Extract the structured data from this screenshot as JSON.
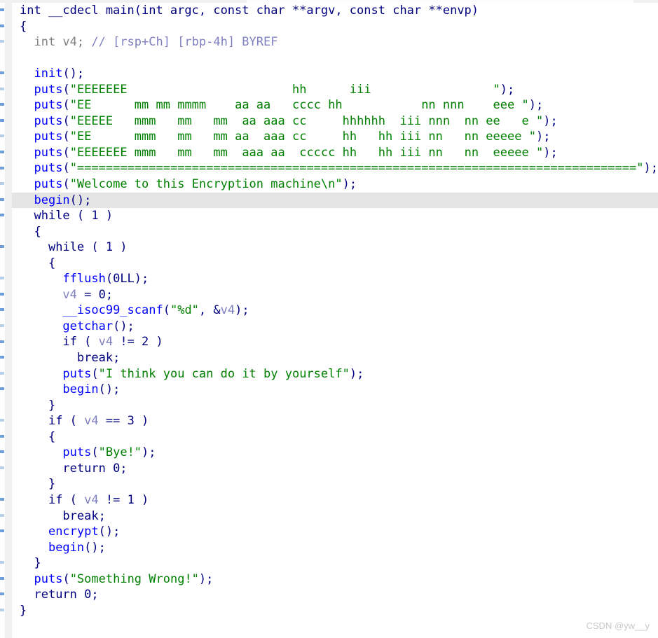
{
  "window": {
    "title": "IDA Pseudocode View",
    "watermark": "CSDN @yw__y"
  },
  "colors": {
    "background": "#ffffff",
    "keyword": "#000080",
    "function": "#0000ff",
    "string": "#008000",
    "variable": "#8080c0",
    "comment": "#808080",
    "highlight_row": "#e4e4e4",
    "gutter_band": "#f0f0f0",
    "gutter_tick": "#6f9fd8",
    "watermark": "#c9c9c9"
  },
  "code": {
    "language": "c-pseudocode",
    "highlighted_line_index": 10,
    "lines": [
      {
        "indent": 0,
        "highlight": false,
        "tokens": [
          {
            "t": "kw",
            "v": "int __cdecl main(int argc, const char **argv, const char **envp)"
          }
        ]
      },
      {
        "indent": 0,
        "highlight": false,
        "tokens": [
          {
            "t": "kw",
            "v": "{"
          }
        ]
      },
      {
        "indent": 2,
        "highlight": false,
        "tokens": [
          {
            "t": "cmt",
            "v": "int v4; "
          },
          {
            "t": "cmt2",
            "v": "// [rsp+Ch] [rbp-4h] BYREF"
          }
        ]
      },
      {
        "indent": 0,
        "highlight": false,
        "tokens": []
      },
      {
        "indent": 2,
        "highlight": false,
        "tokens": [
          {
            "t": "fn",
            "v": "init"
          },
          {
            "t": "kw",
            "v": "();"
          }
        ]
      },
      {
        "indent": 2,
        "highlight": false,
        "tokens": [
          {
            "t": "fn",
            "v": "puts"
          },
          {
            "t": "kw",
            "v": "("
          },
          {
            "t": "str",
            "v": "\"EEEEEEE                       hh      iii                 \""
          },
          {
            "t": "kw",
            "v": ");"
          }
        ]
      },
      {
        "indent": 2,
        "highlight": false,
        "tokens": [
          {
            "t": "fn",
            "v": "puts"
          },
          {
            "t": "kw",
            "v": "("
          },
          {
            "t": "str",
            "v": "\"EE      mm mm mmmm    aa aa   cccc hh           nn nnn    eee \""
          },
          {
            "t": "kw",
            "v": ");"
          }
        ]
      },
      {
        "indent": 2,
        "highlight": false,
        "tokens": [
          {
            "t": "fn",
            "v": "puts"
          },
          {
            "t": "kw",
            "v": "("
          },
          {
            "t": "str",
            "v": "\"EEEEE   mmm   mm   mm  aa aaa cc     hhhhhh  iii nnn  nn ee   e \""
          },
          {
            "t": "kw",
            "v": ");"
          }
        ]
      },
      {
        "indent": 2,
        "highlight": false,
        "tokens": [
          {
            "t": "fn",
            "v": "puts"
          },
          {
            "t": "kw",
            "v": "("
          },
          {
            "t": "str",
            "v": "\"EE      mmm   mm   mm aa  aaa cc     hh   hh iii nn   nn eeeee \""
          },
          {
            "t": "kw",
            "v": ");"
          }
        ]
      },
      {
        "indent": 2,
        "highlight": false,
        "tokens": [
          {
            "t": "fn",
            "v": "puts"
          },
          {
            "t": "kw",
            "v": "("
          },
          {
            "t": "str",
            "v": "\"EEEEEEE mmm   mm   mm  aaa aa  ccccc hh   hh iii nn   nn  eeeee \""
          },
          {
            "t": "kw",
            "v": ");"
          }
        ]
      },
      {
        "indent": 2,
        "highlight": false,
        "tokens": [
          {
            "t": "fn",
            "v": "puts"
          },
          {
            "t": "kw",
            "v": "("
          },
          {
            "t": "str",
            "v": "\"==============================================================================\""
          },
          {
            "t": "kw",
            "v": ");"
          }
        ]
      },
      {
        "indent": 2,
        "highlight": false,
        "tokens": [
          {
            "t": "fn",
            "v": "puts"
          },
          {
            "t": "kw",
            "v": "("
          },
          {
            "t": "str",
            "v": "\"Welcome to this Encryption machine\\n\""
          },
          {
            "t": "kw",
            "v": ");"
          }
        ]
      },
      {
        "indent": 2,
        "highlight": true,
        "tokens": [
          {
            "t": "fn",
            "v": "begin"
          },
          {
            "t": "kw",
            "v": "();"
          }
        ]
      },
      {
        "indent": 2,
        "highlight": false,
        "tokens": [
          {
            "t": "kw",
            "v": "while ( 1 )"
          }
        ]
      },
      {
        "indent": 2,
        "highlight": false,
        "tokens": [
          {
            "t": "kw",
            "v": "{"
          }
        ]
      },
      {
        "indent": 4,
        "highlight": false,
        "tokens": [
          {
            "t": "kw",
            "v": "while ( 1 )"
          }
        ]
      },
      {
        "indent": 4,
        "highlight": false,
        "tokens": [
          {
            "t": "kw",
            "v": "{"
          }
        ]
      },
      {
        "indent": 6,
        "highlight": false,
        "tokens": [
          {
            "t": "fn",
            "v": "fflush"
          },
          {
            "t": "kw",
            "v": "(0LL);"
          }
        ]
      },
      {
        "indent": 6,
        "highlight": false,
        "tokens": [
          {
            "t": "var",
            "v": "v4"
          },
          {
            "t": "kw",
            "v": " = 0;"
          }
        ]
      },
      {
        "indent": 6,
        "highlight": false,
        "tokens": [
          {
            "t": "fn",
            "v": "__isoc99_scanf"
          },
          {
            "t": "kw",
            "v": "("
          },
          {
            "t": "str",
            "v": "\"%d\""
          },
          {
            "t": "kw",
            "v": ", &"
          },
          {
            "t": "var",
            "v": "v4"
          },
          {
            "t": "kw",
            "v": ");"
          }
        ]
      },
      {
        "indent": 6,
        "highlight": false,
        "tokens": [
          {
            "t": "fn",
            "v": "getchar"
          },
          {
            "t": "kw",
            "v": "();"
          }
        ]
      },
      {
        "indent": 6,
        "highlight": false,
        "tokens": [
          {
            "t": "kw",
            "v": "if ( "
          },
          {
            "t": "var",
            "v": "v4"
          },
          {
            "t": "kw",
            "v": " != 2 )"
          }
        ]
      },
      {
        "indent": 8,
        "highlight": false,
        "tokens": [
          {
            "t": "kw",
            "v": "break;"
          }
        ]
      },
      {
        "indent": 6,
        "highlight": false,
        "tokens": [
          {
            "t": "fn",
            "v": "puts"
          },
          {
            "t": "kw",
            "v": "("
          },
          {
            "t": "str",
            "v": "\"I think you can do it by yourself\""
          },
          {
            "t": "kw",
            "v": ");"
          }
        ]
      },
      {
        "indent": 6,
        "highlight": false,
        "tokens": [
          {
            "t": "fn",
            "v": "begin"
          },
          {
            "t": "kw",
            "v": "();"
          }
        ]
      },
      {
        "indent": 4,
        "highlight": false,
        "tokens": [
          {
            "t": "kw",
            "v": "}"
          }
        ]
      },
      {
        "indent": 4,
        "highlight": false,
        "tokens": [
          {
            "t": "kw",
            "v": "if ( "
          },
          {
            "t": "var",
            "v": "v4"
          },
          {
            "t": "kw",
            "v": " == 3 )"
          }
        ]
      },
      {
        "indent": 4,
        "highlight": false,
        "tokens": [
          {
            "t": "kw",
            "v": "{"
          }
        ]
      },
      {
        "indent": 6,
        "highlight": false,
        "tokens": [
          {
            "t": "fn",
            "v": "puts"
          },
          {
            "t": "kw",
            "v": "("
          },
          {
            "t": "str",
            "v": "\"Bye!\""
          },
          {
            "t": "kw",
            "v": ");"
          }
        ]
      },
      {
        "indent": 6,
        "highlight": false,
        "tokens": [
          {
            "t": "kw",
            "v": "return 0;"
          }
        ]
      },
      {
        "indent": 4,
        "highlight": false,
        "tokens": [
          {
            "t": "kw",
            "v": "}"
          }
        ]
      },
      {
        "indent": 4,
        "highlight": false,
        "tokens": [
          {
            "t": "kw",
            "v": "if ( "
          },
          {
            "t": "var",
            "v": "v4"
          },
          {
            "t": "kw",
            "v": " != 1 )"
          }
        ]
      },
      {
        "indent": 6,
        "highlight": false,
        "tokens": [
          {
            "t": "kw",
            "v": "break;"
          }
        ]
      },
      {
        "indent": 4,
        "highlight": false,
        "tokens": [
          {
            "t": "fn",
            "v": "encrypt"
          },
          {
            "t": "kw",
            "v": "();"
          }
        ]
      },
      {
        "indent": 4,
        "highlight": false,
        "tokens": [
          {
            "t": "fn",
            "v": "begin"
          },
          {
            "t": "kw",
            "v": "();"
          }
        ]
      },
      {
        "indent": 2,
        "highlight": false,
        "tokens": [
          {
            "t": "kw",
            "v": "}"
          }
        ]
      },
      {
        "indent": 2,
        "highlight": false,
        "tokens": [
          {
            "t": "fn",
            "v": "puts"
          },
          {
            "t": "kw",
            "v": "("
          },
          {
            "t": "str",
            "v": "\"Something Wrong!\""
          },
          {
            "t": "kw",
            "v": ");"
          }
        ]
      },
      {
        "indent": 2,
        "highlight": false,
        "tokens": [
          {
            "t": "kw",
            "v": "return 0;"
          }
        ]
      },
      {
        "indent": 0,
        "highlight": false,
        "tokens": [
          {
            "t": "kw",
            "v": "}"
          }
        ]
      }
    ]
  },
  "gutter": {
    "tick_lines": [
      0,
      1,
      2,
      4,
      5,
      6,
      7,
      8,
      9,
      10,
      11,
      12,
      13,
      15,
      17,
      18,
      19,
      20,
      21,
      22,
      23,
      24,
      26,
      27,
      28,
      29,
      31,
      32,
      33,
      35,
      36,
      37,
      38
    ]
  }
}
